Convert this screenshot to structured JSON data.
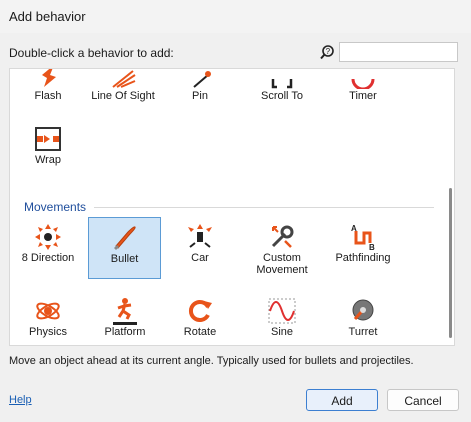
{
  "window": {
    "title": "Add behavior"
  },
  "instruction": "Double-click a behavior to add:",
  "search": {
    "value": "",
    "placeholder": ""
  },
  "behaviors_top": [
    {
      "label": "Flash",
      "icon": "flash-icon"
    },
    {
      "label": "Line Of Sight",
      "icon": "line-of-sight-icon"
    },
    {
      "label": "Pin",
      "icon": "pin-icon"
    },
    {
      "label": "Scroll To",
      "icon": "scroll-to-icon"
    },
    {
      "label": "Timer",
      "icon": "timer-icon"
    },
    {
      "label": "Wrap",
      "icon": "wrap-icon"
    }
  ],
  "category": "Movements",
  "movements": [
    {
      "label": "8 Direction",
      "icon": "8-direction-icon"
    },
    {
      "label": "Bullet",
      "icon": "bullet-icon",
      "selected": true
    },
    {
      "label": "Car",
      "icon": "car-icon"
    },
    {
      "label": "Custom Movement",
      "icon": "custom-movement-icon"
    },
    {
      "label": "Pathfinding",
      "icon": "pathfinding-icon"
    },
    {
      "label": "Physics",
      "icon": "physics-icon"
    },
    {
      "label": "Platform",
      "icon": "platform-icon"
    },
    {
      "label": "Rotate",
      "icon": "rotate-icon"
    },
    {
      "label": "Sine",
      "icon": "sine-icon"
    },
    {
      "label": "Turret",
      "icon": "turret-icon"
    }
  ],
  "description": "Move an object ahead at its current angle.  Typically used for bullets and projectiles.",
  "footer": {
    "help": "Help",
    "add": "Add",
    "cancel": "Cancel"
  },
  "colors": {
    "accent": "#1f4e9c",
    "icon_orange": "#e8541a",
    "selection": "#cfe4f7"
  }
}
